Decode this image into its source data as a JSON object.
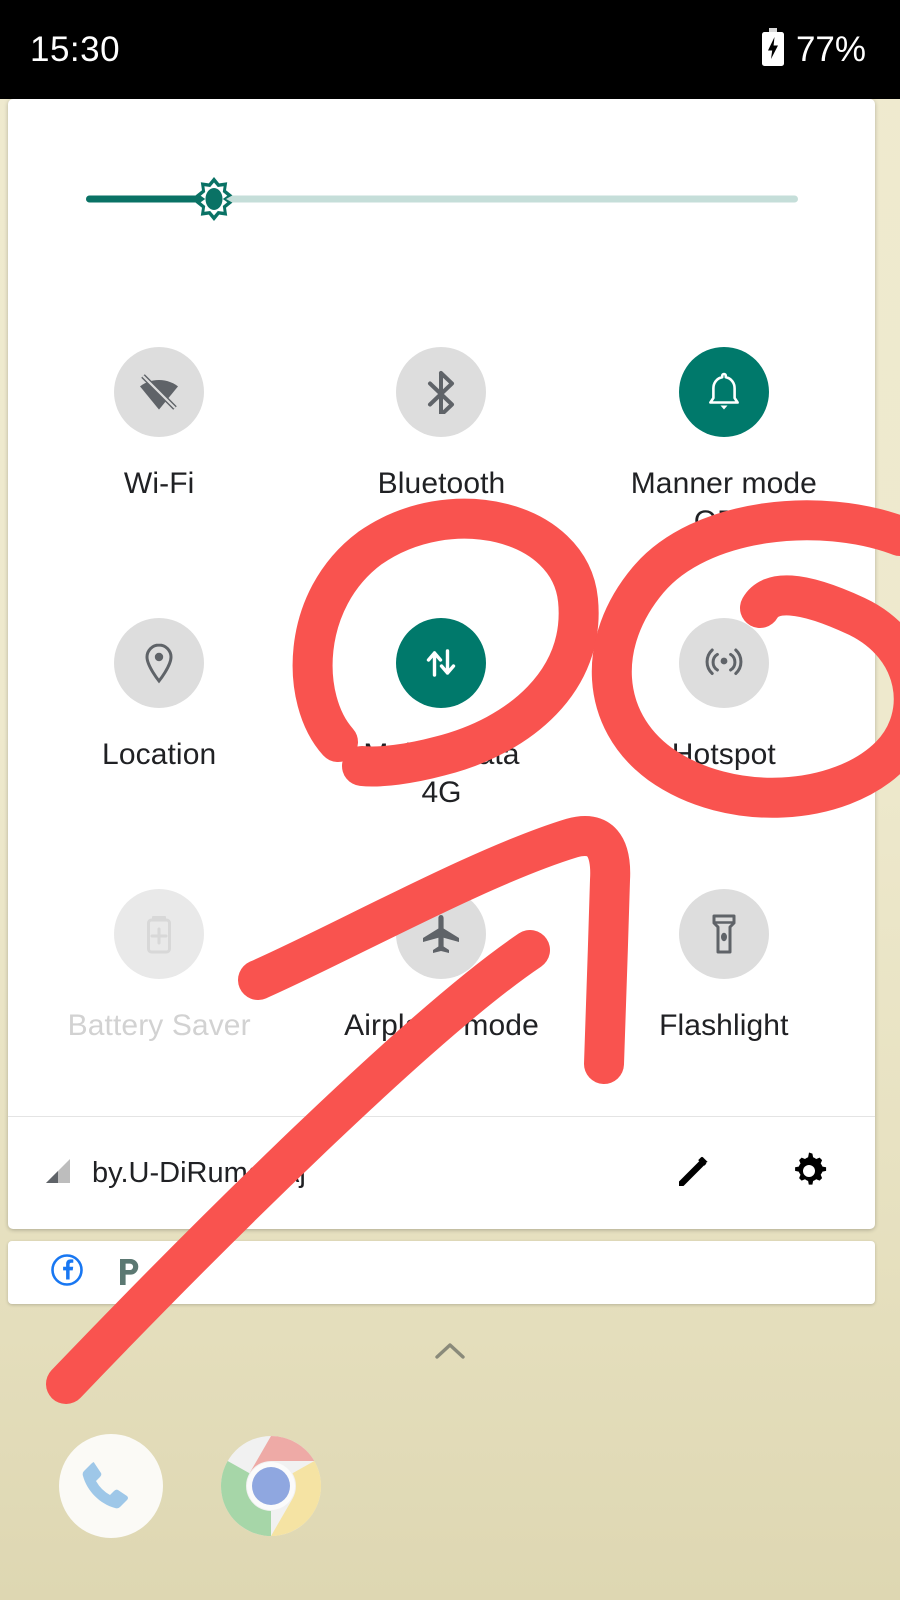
{
  "status_bar": {
    "clock": "15:30",
    "battery_percent": "77%",
    "battery_icon": "battery-charging-icon"
  },
  "quick_settings": {
    "brightness": {
      "name": "brightness-slider",
      "value_percent": 18,
      "thumb_icon": "brightness-sun-icon"
    },
    "tiles": [
      {
        "id": "wifi",
        "label": "Wi-Fi",
        "sub": "",
        "icon": "wifi-off-icon",
        "state": "off"
      },
      {
        "id": "bluetooth",
        "label": "Bluetooth",
        "sub": "",
        "icon": "bluetooth-icon",
        "state": "off"
      },
      {
        "id": "manner-mode",
        "label": "Manner mode",
        "sub": "OFF",
        "icon": "bell-icon",
        "state": "on"
      },
      {
        "id": "location",
        "label": "Location",
        "sub": "",
        "icon": "location-pin-icon",
        "state": "off"
      },
      {
        "id": "mobile-data",
        "label": "Mobile data",
        "sub": "4G",
        "icon": "data-transfer-icon",
        "state": "on"
      },
      {
        "id": "hotspot",
        "label": "Hotspot",
        "sub": "",
        "icon": "hotspot-icon",
        "state": "off"
      },
      {
        "id": "battery-saver",
        "label": "Battery Saver",
        "sub": "",
        "icon": "battery-plus-icon",
        "state": "disabled"
      },
      {
        "id": "airplane-mode",
        "label": "Airplane mode",
        "sub": "",
        "icon": "airplane-icon",
        "state": "off"
      },
      {
        "id": "flashlight",
        "label": "Flashlight",
        "sub": "",
        "icon": "flashlight-icon",
        "state": "off"
      }
    ],
    "footer": {
      "signal_icon": "signal-bars-icon",
      "carrier": "by.U-DiRumahAj",
      "edit_icon": "pencil-edit-icon",
      "settings_icon": "gear-settings-icon"
    }
  },
  "notification_strip": {
    "icons": [
      {
        "name": "facebook-icon",
        "glyph": "f"
      },
      {
        "name": "pinterest-icon",
        "glyph": "P"
      },
      {
        "name": "more-notifications-dot-icon",
        "glyph": "•"
      }
    ]
  },
  "home_screen": {
    "drawer_handle_icon": "chevron-up-icon",
    "dock": [
      {
        "name": "phone-app-icon",
        "label": "Phone"
      },
      {
        "name": "chrome-app-icon",
        "label": "Chrome"
      }
    ]
  },
  "annotations": {
    "color": "#f9534f",
    "marks": [
      {
        "name": "mobile-data-circle-annotation",
        "target": "mobile-data"
      },
      {
        "name": "hotspot-circle-annotation",
        "target": "hotspot"
      },
      {
        "name": "arrow-annotation",
        "target": "airplane-mode-area"
      }
    ]
  },
  "colors": {
    "accent_teal": "#00796b",
    "annotation_red": "#f9534f",
    "tile_off_gray": "#dddddd",
    "wallpaper": "#eee9cd",
    "status_bar_bg": "#000000"
  }
}
